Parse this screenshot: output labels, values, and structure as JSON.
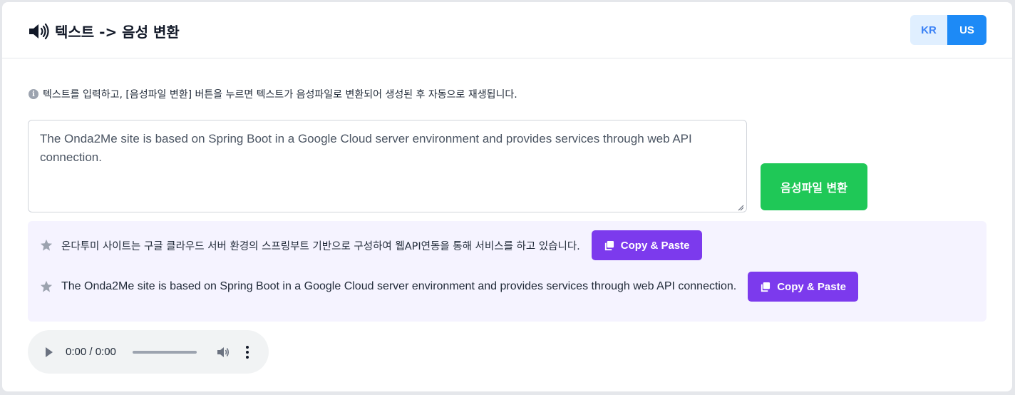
{
  "header": {
    "icon": "speaker-icon",
    "title": "텍스트 -> 음성 변환",
    "languages": [
      {
        "label": "KR",
        "active": false
      },
      {
        "label": "US",
        "active": true
      }
    ]
  },
  "info": {
    "icon": "info-icon",
    "text": "텍스트를 입력하고, [음성파일 변환] 버튼을 누르면 텍스트가 음성파일로 변환되어 생성된 후 자동으로 재생됩니다."
  },
  "input": {
    "value": "The Onda2Me site is based on Spring Boot in a Google Cloud server environment and provides services through web API connection."
  },
  "convert_button": {
    "label": "음성파일 변환",
    "color": "#1fc857"
  },
  "results": [
    {
      "text": "온다투미 사이트는 구글 클라우드 서버 환경의 스프링부트 기반으로 구성하여 웹API연동을 통해 서비스를 하고 있습니다.",
      "button": "Copy & Paste"
    },
    {
      "text": "The Onda2Me site is based on Spring Boot in a Google Cloud server environment and provides services through web API connection.",
      "button": "Copy & Paste"
    }
  ],
  "audio": {
    "time": "0:00 / 0:00",
    "progress": 0
  },
  "colors": {
    "accent_blue": "#1d8af6",
    "accent_purple": "#7c3aed",
    "accent_green": "#1fc857"
  }
}
